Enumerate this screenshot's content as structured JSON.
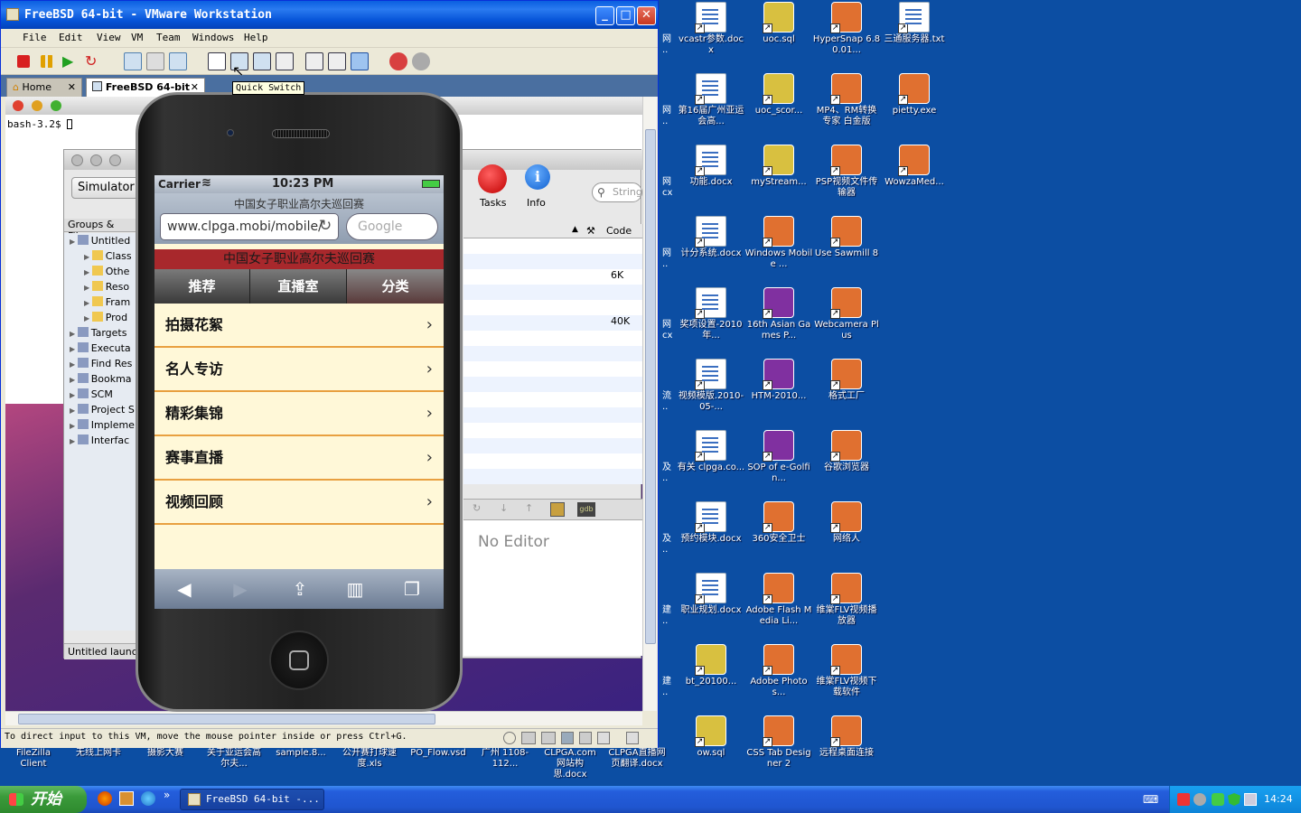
{
  "desktop": {
    "icons": [
      {
        "label": "vcastr参数.docx",
        "type": "doc"
      },
      {
        "label": "uoc.sql",
        "type": "file"
      },
      {
        "label": "HyperSnap 6.80.01...",
        "type": "app"
      },
      {
        "label": "三通服务器.txt",
        "type": "txt"
      },
      {
        "label": "第16届广州亚运会高...",
        "type": "doc"
      },
      {
        "label": "uoc_scor...",
        "type": "file"
      },
      {
        "label": "MP4、RM转换专家 白金版",
        "type": "app"
      },
      {
        "label": "pietty.exe",
        "type": "app"
      },
      {
        "label": "功能.docx",
        "type": "doc"
      },
      {
        "label": "myStream...",
        "type": "file"
      },
      {
        "label": "PSP视频文件传输器",
        "type": "app"
      },
      {
        "label": "WowzaMed...",
        "type": "app"
      },
      {
        "label": "计分系统.docx",
        "type": "doc"
      },
      {
        "label": "Windows Mobile ...",
        "type": "app"
      },
      {
        "label": "Use Sawmill 8",
        "type": "app"
      },
      {
        "label": "奖项设置-2010年...",
        "type": "doc"
      },
      {
        "label": "16th Asian Games P...",
        "type": "rar"
      },
      {
        "label": "Webcamera Plus",
        "type": "app"
      },
      {
        "label": "视频模版.2010-05-...",
        "type": "doc"
      },
      {
        "label": "HTM-2010...",
        "type": "rar"
      },
      {
        "label": "格式工厂",
        "type": "app"
      },
      {
        "label": "有关 clpga.co...",
        "type": "doc"
      },
      {
        "label": "SOP of e-Golfin...",
        "type": "rar"
      },
      {
        "label": "谷歌浏览器",
        "type": "app"
      },
      {
        "label": "预约模块.docx",
        "type": "doc"
      },
      {
        "label": "360安全卫士",
        "type": "app"
      },
      {
        "label": "网络人",
        "type": "app"
      },
      {
        "label": "职业规划.docx",
        "type": "doc"
      },
      {
        "label": "Adobe Flash Media Li...",
        "type": "app"
      },
      {
        "label": "维棠FLV视频播放器",
        "type": "app"
      },
      {
        "label": "bt_20100...",
        "type": "file"
      },
      {
        "label": "Adobe Photos...",
        "type": "app"
      },
      {
        "label": "维棠FLV视频下载软件",
        "type": "app"
      },
      {
        "label": "ow.sql",
        "type": "file"
      },
      {
        "label": "CSS Tab Designer 2",
        "type": "app"
      },
      {
        "label": "远程桌面连接",
        "type": "app"
      }
    ],
    "edge_labels": [
      "网",
      "网",
      "网",
      "网",
      "网",
      "流",
      "及",
      "及",
      "建",
      "建"
    ],
    "edge_sub": [
      "..",
      "..",
      "cx",
      "..",
      "cx",
      "..",
      "..",
      "..",
      "..",
      ".."
    ],
    "bottom_row": [
      {
        "label": "FileZilla Client"
      },
      {
        "label": "无线上网卡"
      },
      {
        "label": "摄影大赛"
      },
      {
        "label": "关于亚运会高尔夫..."
      },
      {
        "label": "sample.8..."
      },
      {
        "label": "公开赛打球速度.xls"
      },
      {
        "label": "PO_Flow.vsd"
      },
      {
        "label": "广州 1108-112..."
      },
      {
        "label": "CLPGA.com网站构思.docx"
      },
      {
        "label": "CLPGA直播网页翻译.docx"
      }
    ]
  },
  "vmware": {
    "title": "FreeBSD 64-bit - VMware Workstation",
    "menu": [
      "File",
      "Edit",
      "View",
      "VM",
      "Team",
      "Windows",
      "Help"
    ],
    "tabs": [
      {
        "label": "Home"
      },
      {
        "label": "FreeBSD 64-bit"
      }
    ],
    "tooltip": "Quick Switch",
    "status": "To direct input to this VM, move the mouse pointer inside or press Ctrl+G.",
    "terminal_prompt": "bash-3.2$"
  },
  "xcode": {
    "simulator_label": "Simulator",
    "groups_header": "Groups & Files",
    "tree": [
      {
        "label": "Untitled",
        "indent": 0
      },
      {
        "label": "Class",
        "indent": 1
      },
      {
        "label": "Othe",
        "indent": 1
      },
      {
        "label": "Reso",
        "indent": 1
      },
      {
        "label": "Fram",
        "indent": 1
      },
      {
        "label": "Prod",
        "indent": 1
      },
      {
        "label": "Targets",
        "indent": 0
      },
      {
        "label": "Executa",
        "indent": 0
      },
      {
        "label": "Find Res",
        "indent": 0
      },
      {
        "label": "Bookma",
        "indent": 0
      },
      {
        "label": "SCM",
        "indent": 0
      },
      {
        "label": "Project S",
        "indent": 0
      },
      {
        "label": "Impleme",
        "indent": 0
      },
      {
        "label": "Interfac",
        "indent": 0
      }
    ],
    "tasks_label": "Tasks",
    "info_label": "Info",
    "search_placeholder": "String",
    "code_col": "Code",
    "sizes": [
      "6K",
      "40K"
    ],
    "no_editor": "No Editor",
    "bottom_status": "Untitled launc"
  },
  "iphone": {
    "carrier": "Carrier",
    "time": "10:23 PM",
    "page_title": "中国女子职业高尔夫巡回赛",
    "url": "www.clpga.mobi/mobile/",
    "search_placeholder": "Google",
    "banner": "中国女子职业高尔夫巡回赛",
    "tabs": [
      "推荐",
      "直播室",
      "分类"
    ],
    "rows": [
      "拍摄花絮",
      "名人专访",
      "精彩集锦",
      "赛事直播",
      "视频回顾"
    ]
  },
  "taskbar": {
    "start": "开始",
    "task": "FreeBSD 64-bit -...",
    "clock": "14:24"
  },
  "colors": {
    "desktop": "#0c4ea3",
    "accent": "#a8282c",
    "row_border": "#e8a040"
  }
}
